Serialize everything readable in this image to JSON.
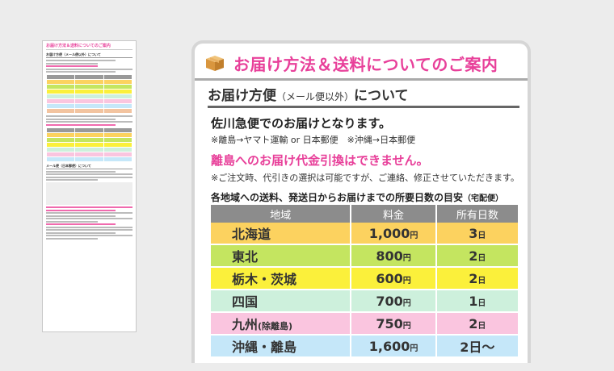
{
  "thumbnail": {
    "title": "お届け方法＆送料についてのご案内",
    "section1": "お届け方便（メール便以外）について",
    "section2": "メール便（日本郵便）について"
  },
  "page": {
    "title": "お届け方法＆送料についてのご案内",
    "icon": "box-icon",
    "section_heading": "お届け方便",
    "section_heading_sub": "（メール便以外）",
    "section_heading_suffix": "について",
    "carrier_line": "佐川急便でのお届けとなります。",
    "island_note": "※離島→ヤマト運輸 or 日本郵便　※沖縄→日本郵便",
    "cod_warning": "離島へのお届け代金引換はできません。",
    "order_note": "※ご注文時、代引きの選択は可能ですが、ご連絡、修正させていただきます。",
    "table_caption": "各地域への送料、発送日からお届けまでの所要日数の目安",
    "table_caption_sub": "（宅配便）"
  },
  "table": {
    "headers": [
      "地域",
      "料金",
      "所有日数"
    ],
    "yen_unit": "円",
    "day_unit": "日",
    "rows": [
      {
        "region": "北海道",
        "region_sub": "",
        "price": "1,000",
        "days": "3",
        "color": "#fcd25f"
      },
      {
        "region": "東北",
        "region_sub": "",
        "price": "800",
        "days": "2",
        "color": "#c4e560"
      },
      {
        "region": "栃木・茨城",
        "region_sub": "",
        "price": "600",
        "days": "2",
        "color": "#fbf03b"
      },
      {
        "region": "四国",
        "region_sub": "",
        "price": "700",
        "days": "1",
        "color": "#cdf0dc"
      },
      {
        "region": "九州",
        "region_sub": "(除離島)",
        "price": "750",
        "days": "2",
        "color": "#fac5df"
      },
      {
        "region": "沖縄・離島",
        "region_sub": "",
        "price": "1,600",
        "days": "2日〜",
        "color": "#c5e7f9"
      }
    ]
  },
  "colors": {
    "accent_pink": "#e8409a",
    "header_gray": "#8c8c8c"
  }
}
